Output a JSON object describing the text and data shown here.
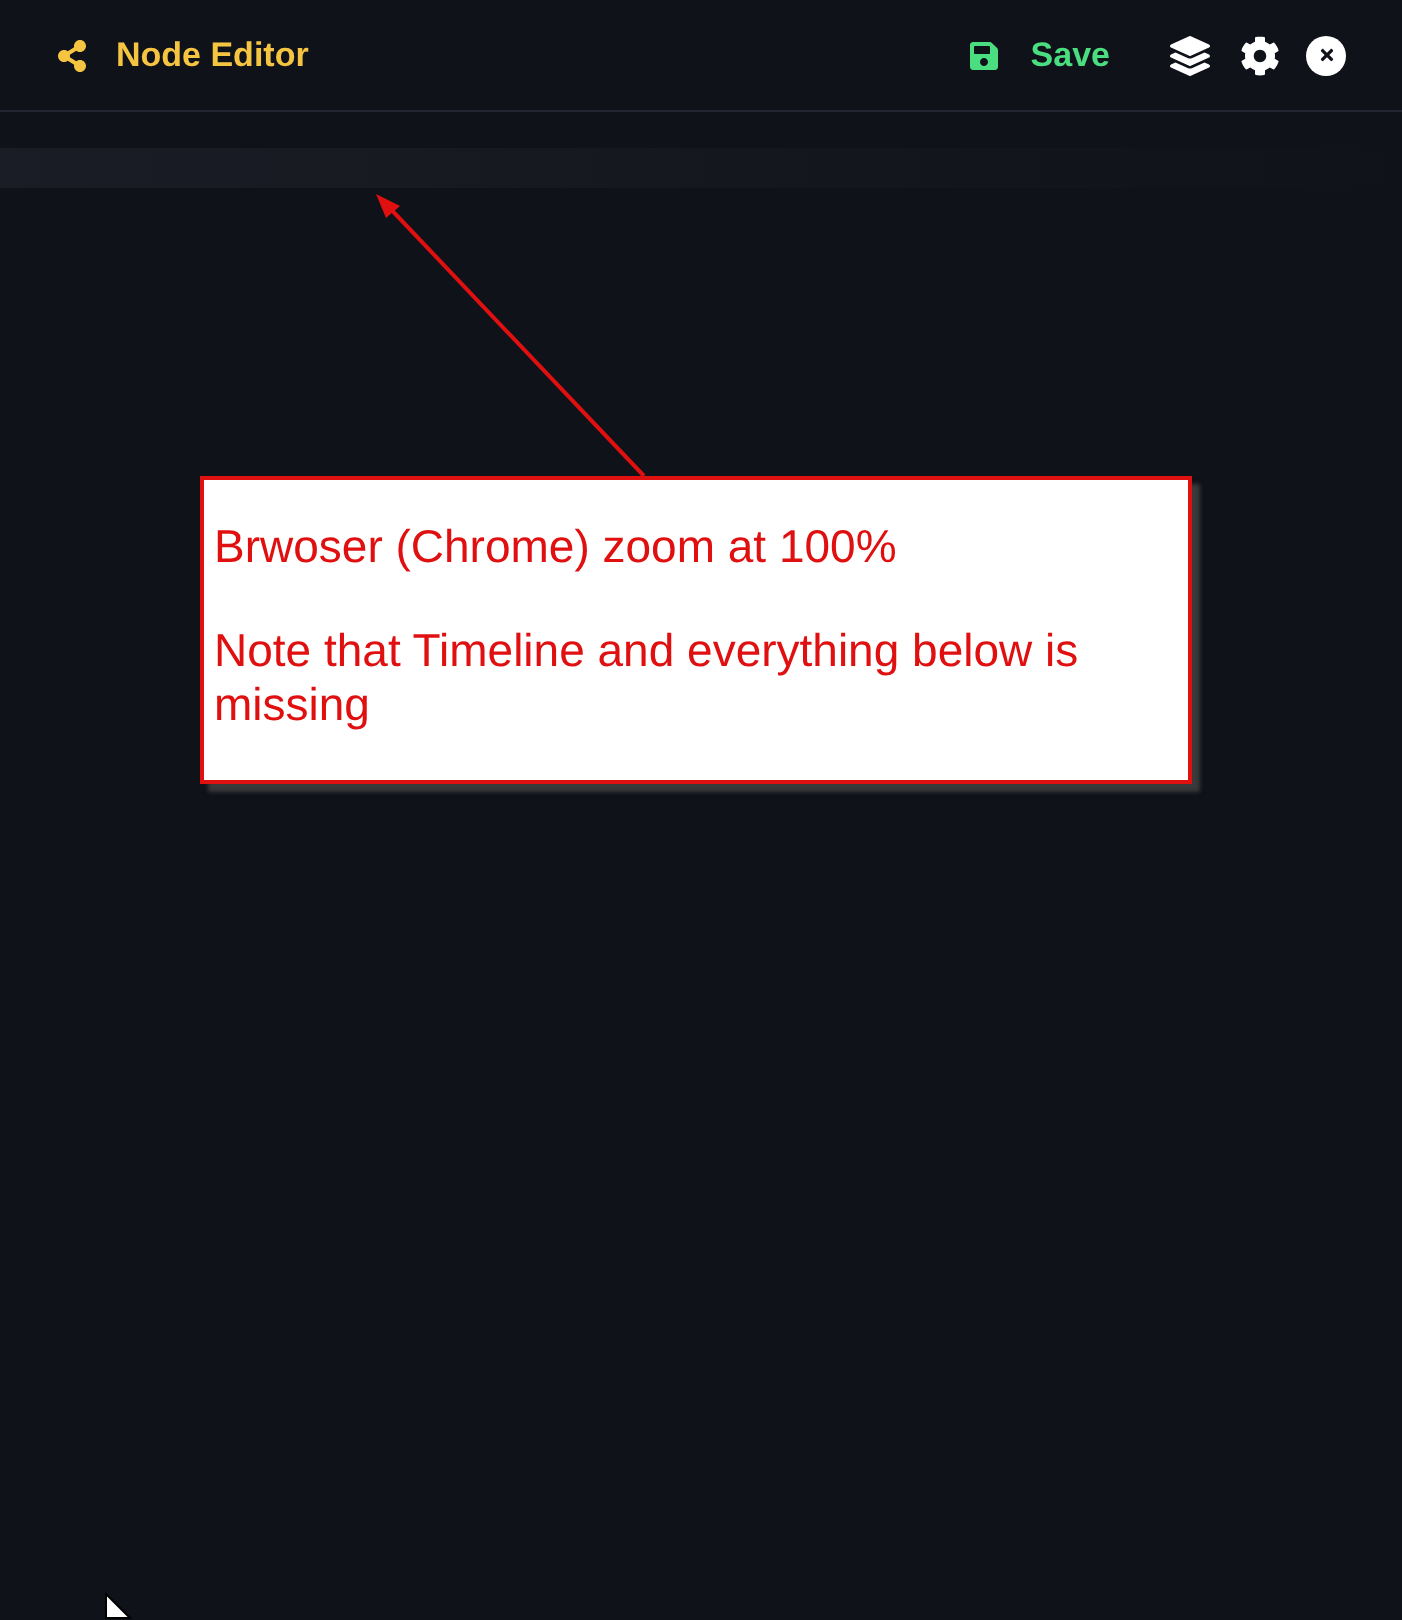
{
  "header": {
    "title": "Node Editor",
    "save_label": "Save"
  },
  "annotation": {
    "lines": [
      "Brwoser (Chrome) zoom at 100%",
      "Note that Timeline and everything below is missing"
    ]
  }
}
